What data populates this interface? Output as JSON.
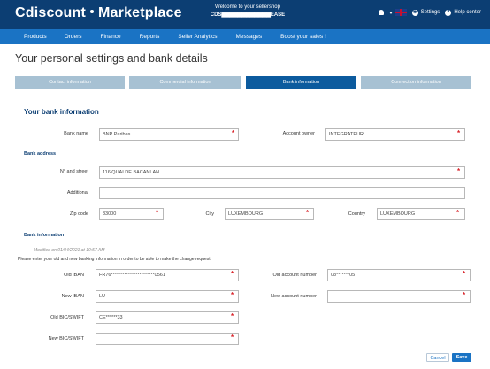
{
  "header": {
    "logo_brand": "Cdiscount",
    "logo_product": "Marketplace",
    "welcome_text": "Welcome to your sellershop",
    "shop_name": "CDS▆▆▆▆▆▆▆▆▆▆▆▆EASE",
    "settings_label": "Settings",
    "help_label": "Help center"
  },
  "nav": {
    "items": [
      "Products",
      "Orders",
      "Finance",
      "Reports",
      "Seller Analytics",
      "Messages",
      "Boost your sales !"
    ]
  },
  "page_title": "Your personal settings and bank details",
  "tabs": [
    "Contact information",
    "Commercial information",
    "Bank information",
    "Connection information"
  ],
  "bank_info": {
    "section_title": "Your bank information",
    "bank_name_label": "Bank name",
    "bank_name_value": "BNP Paribas",
    "account_owner_label": "Account owner",
    "account_owner_value": "INTEGRATEUR"
  },
  "bank_address": {
    "title": "Bank address",
    "street_label": "N° and street",
    "street_value": "116 QUAI DE BACANLAN",
    "additional_label": "Additional",
    "additional_value": "",
    "zip_label": "Zip code",
    "zip_value": "33000",
    "city_label": "City",
    "city_value": "LUXEMBOURG",
    "country_label": "Country",
    "country_value": "LUXEMBOURG"
  },
  "bank_information": {
    "title": "Bank information",
    "modified": "Modified on 01/04/2021 at 10:57 AM",
    "instruction": "Please enter your old and new banking information in order to be able to make the change request.",
    "old_iban_label": "Old IBAN",
    "old_iban_value": "FR76***********************0561",
    "old_account_label": "Old account number",
    "old_account_value": "08*******05",
    "new_iban_label": "New IBAN",
    "new_iban_value": "LU",
    "new_account_label": "New account number",
    "new_account_value": "",
    "old_bic_label": "Old BIC/SWIFT",
    "old_bic_value": "CE******33",
    "new_bic_label": "New BIC/SWIFT",
    "new_bic_value": ""
  },
  "actions": {
    "cancel": "Cancel",
    "save": "Save"
  },
  "colors": {
    "header_bg": "#0c3e73",
    "nav_bg": "#1a73c4",
    "tab_inactive": "#a7c1d3",
    "tab_active": "#0c5b9e",
    "required": "#d8232a"
  }
}
